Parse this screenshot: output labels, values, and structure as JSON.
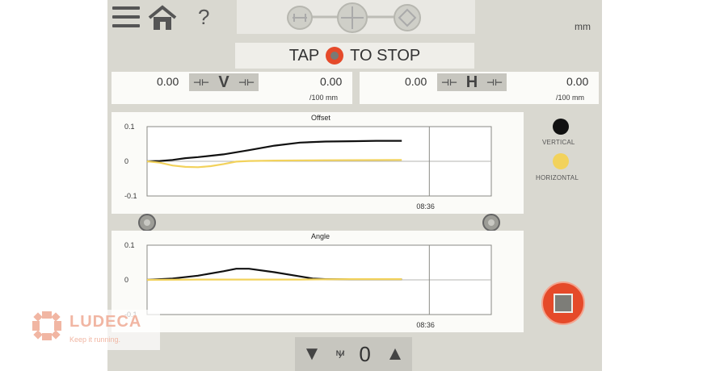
{
  "header": {
    "units": "mm",
    "help": "?"
  },
  "tap_bar": {
    "left": "TAP",
    "right": "TO STOP"
  },
  "vertical_readout": {
    "left_value": "0.00",
    "axis": "V",
    "right_value": "0.00",
    "unit": "/100 mm"
  },
  "horizontal_readout": {
    "left_value": "0.00",
    "axis": "H",
    "right_value": "0.00",
    "unit": "/100 mm"
  },
  "legend": {
    "vertical": {
      "label": "VERTICAL",
      "color": "#111111"
    },
    "horizontal": {
      "label": "HORIZONTAL",
      "color": "#f2d25c"
    }
  },
  "bottom_bar": {
    "count": "0"
  },
  "brand": {
    "name": "LUDECA",
    "tagline": "Keep it running."
  },
  "colors": {
    "accent_red": "#e54a2a",
    "vertical_line": "#111111",
    "horizontal_line": "#f2d25c"
  },
  "chart_data": [
    {
      "type": "line",
      "title": "Offset",
      "ylim": [
        -0.1,
        0.1
      ],
      "yticks": [
        "0.1",
        "0",
        "-0.1"
      ],
      "xtick_label": "08:36",
      "grid": true,
      "series": [
        {
          "name": "VERTICAL",
          "color": "#111111",
          "x": [
            0,
            0.05,
            0.1,
            0.15,
            0.2,
            0.3,
            0.4,
            0.5,
            0.6,
            0.7,
            0.8,
            0.9,
            1.0
          ],
          "y": [
            0,
            0.001,
            0.004,
            0.009,
            0.012,
            0.02,
            0.032,
            0.045,
            0.054,
            0.057,
            0.058,
            0.059,
            0.059
          ]
        },
        {
          "name": "HORIZONTAL",
          "color": "#f2d25c",
          "x": [
            0,
            0.05,
            0.1,
            0.15,
            0.2,
            0.25,
            0.3,
            0.35,
            0.4,
            0.5,
            0.7,
            1.0
          ],
          "y": [
            0,
            -0.004,
            -0.012,
            -0.016,
            -0.017,
            -0.014,
            -0.008,
            -0.001,
            0.001,
            0.002,
            0.003,
            0.004
          ]
        }
      ]
    },
    {
      "type": "line",
      "title": "Angle",
      "ylim": [
        -0.1,
        0.1
      ],
      "yticks": [
        "0.1",
        "0",
        "-0.1"
      ],
      "xtick_label": "08:36",
      "grid": true,
      "series": [
        {
          "name": "VERTICAL",
          "color": "#111111",
          "x": [
            0,
            0.1,
            0.2,
            0.3,
            0.35,
            0.4,
            0.5,
            0.6,
            0.65,
            0.7,
            0.8,
            1.0
          ],
          "y": [
            0,
            0.004,
            0.012,
            0.025,
            0.032,
            0.032,
            0.022,
            0.01,
            0.004,
            0.002,
            0.002,
            0.002
          ]
        },
        {
          "name": "HORIZONTAL",
          "color": "#f2d25c",
          "x": [
            0,
            0.2,
            0.4,
            0.6,
            0.8,
            1.0
          ],
          "y": [
            0,
            0.001,
            0.001,
            0.001,
            0.002,
            0.002
          ]
        }
      ]
    }
  ]
}
